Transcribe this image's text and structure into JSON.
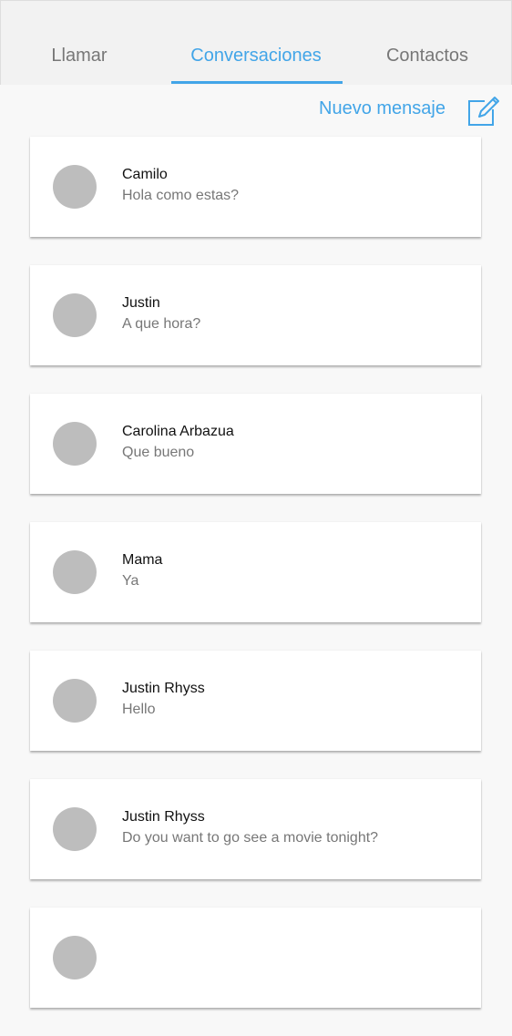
{
  "tabs": [
    {
      "label": "Llamar",
      "active": false
    },
    {
      "label": "Conversaciones",
      "active": true
    },
    {
      "label": "Contactos",
      "active": false
    }
  ],
  "new_message": {
    "label": "Nuevo mensaje",
    "icon": "compose-icon"
  },
  "colors": {
    "accent": "#42a5e8",
    "avatar": "#bdbdbd",
    "tabbar": "#f2f2f2",
    "background": "#f8f8f8"
  },
  "conversations": [
    {
      "name": "Camilo",
      "preview": "Hola como estas?"
    },
    {
      "name": "Justin",
      "preview": "A que hora?"
    },
    {
      "name": "Carolina Arbazua",
      "preview": "Que bueno"
    },
    {
      "name": "Mama",
      "preview": "Ya"
    },
    {
      "name": "Justin Rhyss",
      "preview": "Hello"
    },
    {
      "name": "Justin Rhyss",
      "preview": "Do you want to go see a movie tonight?"
    },
    {
      "name": "",
      "preview": ""
    }
  ]
}
